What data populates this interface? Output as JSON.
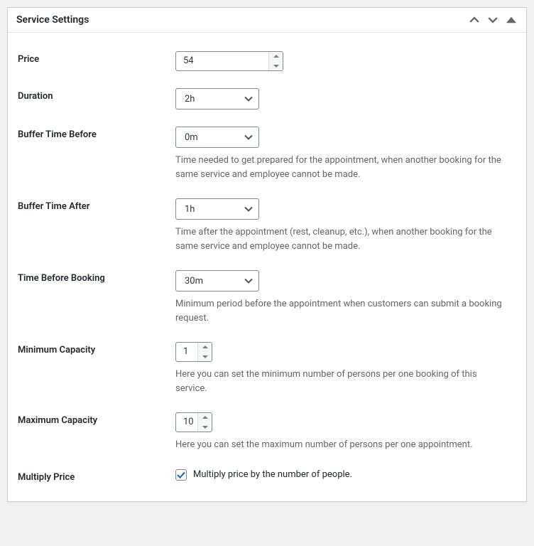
{
  "panel": {
    "title": "Service Settings"
  },
  "fields": {
    "price": {
      "label": "Price",
      "value": "54"
    },
    "duration": {
      "label": "Duration",
      "value": "2h"
    },
    "buffer_before": {
      "label": "Buffer Time Before",
      "value": "0m",
      "help": "Time needed to get prepared for the appointment, when another booking for the same service and employee cannot be made."
    },
    "buffer_after": {
      "label": "Buffer Time After",
      "value": "1h",
      "help": "Time after the appointment (rest, cleanup, etc.), when another booking for the same service and employee cannot be made."
    },
    "time_before_booking": {
      "label": "Time Before Booking",
      "value": "30m",
      "help": "Minimum period before the appointment when customers can submit a booking request."
    },
    "min_capacity": {
      "label": "Minimum Capacity",
      "value": "1",
      "help": "Here you can set the minimum number of persons per one booking of this service."
    },
    "max_capacity": {
      "label": "Maximum Capacity",
      "value": "10",
      "help": "Here you can set the maximum number of persons per one appointment."
    },
    "multiply_price": {
      "label": "Multiply Price",
      "checkbox_label": "Multiply price by the number of people.",
      "checked": true
    }
  }
}
